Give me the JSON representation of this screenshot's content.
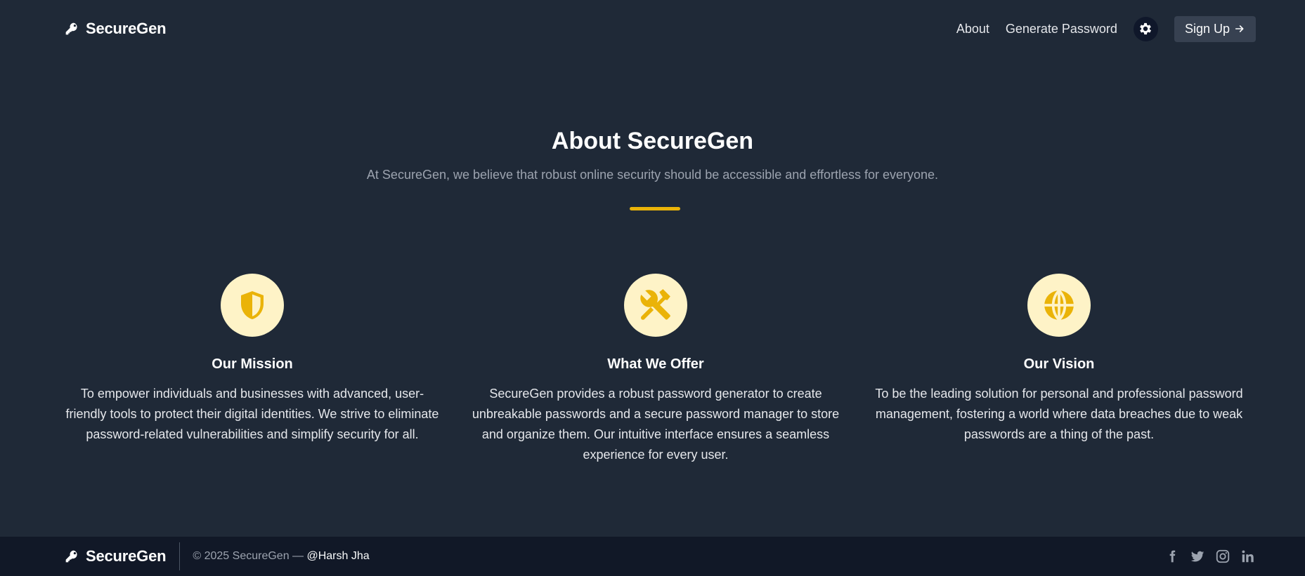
{
  "nav": {
    "brand": "SecureGen",
    "links": [
      "About",
      "Generate Password"
    ],
    "signup_label": "Sign Up",
    "theme_icon": "gear-icon"
  },
  "hero": {
    "title": "About SecureGen",
    "subtitle": "At SecureGen, we believe that robust online security should be accessible and effortless for everyone."
  },
  "cards": [
    {
      "icon": "shield-icon",
      "title": "Our Mission",
      "text": "To empower individuals and businesses with advanced, user-friendly tools to protect their digital identities. We strive to eliminate password-related vulnerabilities and simplify security for all."
    },
    {
      "icon": "tools-icon",
      "title": "What We Offer",
      "text": "SecureGen provides a robust password generator to create unbreakable passwords and a secure password manager to store and organize them. Our intuitive interface ensures a seamless experience for every user."
    },
    {
      "icon": "globe-icon",
      "title": "Our Vision",
      "text": "To be the leading solution for personal and professional password management, fostering a world where data breaches due to weak passwords are a thing of the past."
    }
  ],
  "footer": {
    "brand": "SecureGen",
    "copyright": "© 2025 SecureGen — ",
    "author": "@Harsh Jha",
    "socials": [
      "facebook-icon",
      "twitter-icon",
      "instagram-icon",
      "linkedin-icon"
    ]
  },
  "colors": {
    "background": "#1f2937",
    "footer_background": "#111827",
    "accent": "#eab308",
    "icon_circle": "#fef3c7"
  }
}
